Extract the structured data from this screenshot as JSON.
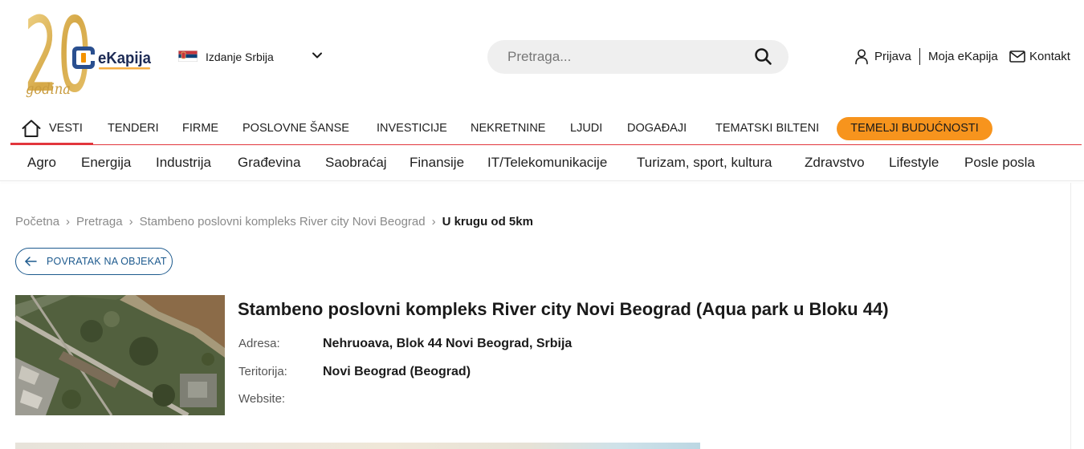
{
  "logo": {
    "number": "20",
    "word": "godina",
    "brand": "eKapija"
  },
  "edition": {
    "label": "Izdanje Srbija",
    "flag": "serbia-flag"
  },
  "search": {
    "placeholder": "Pretraga..."
  },
  "header_links": {
    "login": "Prijava",
    "account": "Moja eKapija",
    "contact": "Kontakt"
  },
  "main_nav": {
    "items": [
      {
        "label": "VESTI",
        "active": true
      },
      {
        "label": "TENDERI"
      },
      {
        "label": "FIRME"
      },
      {
        "label": "POSLOVNE ŠANSE"
      },
      {
        "label": "INVESTICIJE"
      },
      {
        "label": "NEKRETNINE"
      },
      {
        "label": "LJUDI"
      },
      {
        "label": "DOGAĐAJI"
      },
      {
        "label": "TEMATSKI BILTENI"
      }
    ],
    "highlight": "TEMELJI BUDUĆNOSTI"
  },
  "sub_nav": {
    "items": [
      "Agro",
      "Energija",
      "Industrija",
      "Građevina",
      "Saobraćaj",
      "Finansije",
      "IT/Telekomunikacije",
      "Turizam, sport, kultura",
      "Zdravstvo",
      "Lifestyle",
      "Posle posla"
    ]
  },
  "breadcrumb": {
    "separator": "›",
    "items": [
      "Početna",
      "Pretraga",
      "Stambeno poslovni kompleks River city Novi Beograd"
    ],
    "current": "U krugu od 5km"
  },
  "back_button": {
    "label": "POVRATAK NA OBJEKAT"
  },
  "object": {
    "title": "Stambeno poslovni kompleks River city Novi Beograd (Aqua park u Bloku 44)",
    "fields": [
      {
        "label": "Adresa:",
        "value": "Nehruoava, Blok 44 Novi Beograd, Srbija"
      },
      {
        "label": "Teritorija:",
        "value": "Novi Beograd (Beograd)"
      },
      {
        "label": "Website:"
      }
    ]
  },
  "colors": {
    "nav_accent": "#e2363c",
    "highlight_bg": "#f7941d",
    "link_blue": "#1d5a8e",
    "logo_gold": "#d6a948",
    "brand_blue": "#2a4f8f",
    "brand_orange": "#f39200"
  },
  "icons": {
    "edition_chevron": "chevron-down-icon",
    "search": "search-icon",
    "login": "user-icon",
    "contact": "mail-icon",
    "home": "home-icon",
    "back": "arrow-left-icon"
  }
}
